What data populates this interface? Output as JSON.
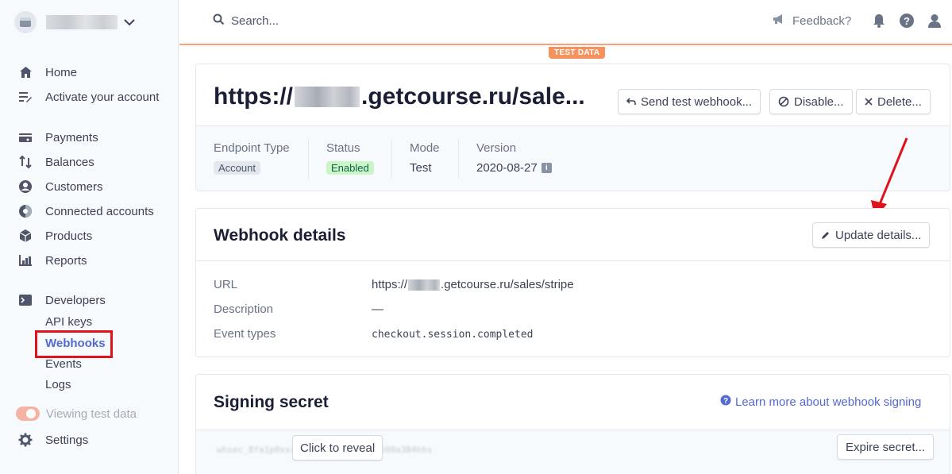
{
  "sidebar": {
    "account_name": "",
    "items": [
      {
        "label": "Home",
        "icon": "home-icon"
      },
      {
        "label": "Activate your account",
        "icon": "activate-icon"
      },
      {
        "label": "Payments",
        "icon": "payments-icon"
      },
      {
        "label": "Balances",
        "icon": "balances-icon"
      },
      {
        "label": "Customers",
        "icon": "customers-icon"
      },
      {
        "label": "Connected accounts",
        "icon": "connected-accounts-icon"
      },
      {
        "label": "Products",
        "icon": "products-icon"
      },
      {
        "label": "Reports",
        "icon": "reports-icon"
      },
      {
        "label": "Developers",
        "icon": "developers-icon"
      }
    ],
    "developer_sub": [
      "API keys",
      "Webhooks",
      "Events",
      "Logs"
    ],
    "viewing_test_data": "Viewing test data",
    "settings": "Settings"
  },
  "topbar": {
    "search_placeholder": "Search...",
    "feedback": "Feedback?",
    "test_data_badge": "TEST DATA"
  },
  "endpoint": {
    "title_prefix": "https://",
    "title_suffix": ".getcourse.ru/sale...",
    "buttons": {
      "send_test": "Send test webhook...",
      "disable": "Disable...",
      "delete": "Delete..."
    },
    "meta": {
      "endpoint_type_label": "Endpoint Type",
      "endpoint_type_value": "Account",
      "status_label": "Status",
      "status_value": "Enabled",
      "mode_label": "Mode",
      "mode_value": "Test",
      "version_label": "Version",
      "version_value": "2020-08-27"
    }
  },
  "webhook_details": {
    "title": "Webhook details",
    "update_button": "Update details...",
    "url_label": "URL",
    "url_prefix": "https://",
    "url_suffix": ".getcourse.ru/sales/stripe",
    "description_label": "Description",
    "description_value": "—",
    "event_types_label": "Event types",
    "event_types_value": "checkout.session.completed"
  },
  "signing_secret": {
    "title": "Signing secret",
    "learn_more": "Learn more about webhook signing",
    "masked_secret": "whsec_8fa1p0xxxxxxxxxxxxxxxxxx1508a3B4hhs",
    "reveal_button": "Click to reveal",
    "expire_button": "Expire secret..."
  },
  "colors": {
    "accent": "#5469d4",
    "highlight_box": "#e0121b",
    "test_badge": "#f5925e",
    "arrow": "#e0121b"
  }
}
